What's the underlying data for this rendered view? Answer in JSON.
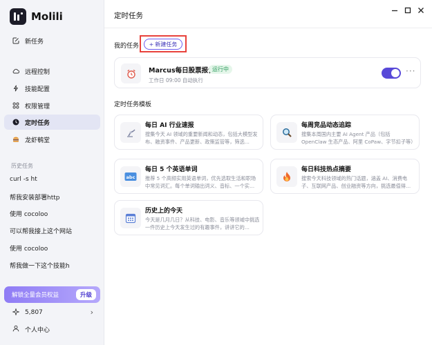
{
  "app": {
    "name": "Molili"
  },
  "sidebar": {
    "new_task": "新任务",
    "items": [
      {
        "label": "远程控制"
      },
      {
        "label": "技能配置"
      },
      {
        "label": "权限管理"
      },
      {
        "label": "定时任务"
      },
      {
        "label": "龙虾鹌堂"
      }
    ],
    "history_label": "历史任务",
    "history": [
      "curl -s ht",
      "帮我安装部署http",
      "使用 cocoloo",
      "可以帮我接上这个网站",
      "使用 cocoloo",
      "帮我做一下这个技能h"
    ],
    "promo_text": "解锁全量会员权益",
    "promo_button": "升级",
    "credits": "5,807",
    "user_center": "个人中心"
  },
  "header": {
    "title": "定时任务"
  },
  "my_tasks": {
    "section_title": "我的任务",
    "new_button": "新建任务",
    "items": [
      {
        "name": "Marcus每日股票报告",
        "status": "运行中",
        "schedule": "工作日 09:00 自动执行",
        "enabled": true
      }
    ]
  },
  "templates": {
    "section_title": "定时任务模板",
    "items": [
      {
        "name": "每日 AI 行业速报",
        "desc": "搜集今天 AI 领域的重要新闻和动态，包括大模型发布、融资事件、产品更新、政策监管等，筛选…",
        "icon": "robot-arm-icon"
      },
      {
        "name": "每周竞品动态追踪",
        "desc": "搜集本周国内主要 AI Agent 产品（包括 OpenClaw 生态产品、阿里 CoPaw、字节扣子等）的最新动…",
        "icon": "magnifier-icon"
      },
      {
        "name": "每日 5 个英语单词",
        "desc": "推荐 5 个高频实用英语单词，优先选取生活和职场中常见词汇。每个单词输出词义、音标、一个实…",
        "icon": "abc-icon"
      },
      {
        "name": "每日科技热点摘要",
        "desc": "搜索今天科技领域的热门话题，涵盖 AI、消费电子、互联网产品、创业融资等方向，挑选最值得…",
        "icon": "flame-icon"
      },
      {
        "name": "历史上的今天",
        "desc": "今天是几月几日？从科技、电影、音乐等领域中挑选一件历史上今天发生过的有趣事件，讲讲它的…",
        "icon": "calendar-icon"
      }
    ]
  },
  "colors": {
    "accent": "#5849d8",
    "success": "#2f9d5f",
    "highlight_box": "#e8413b"
  }
}
